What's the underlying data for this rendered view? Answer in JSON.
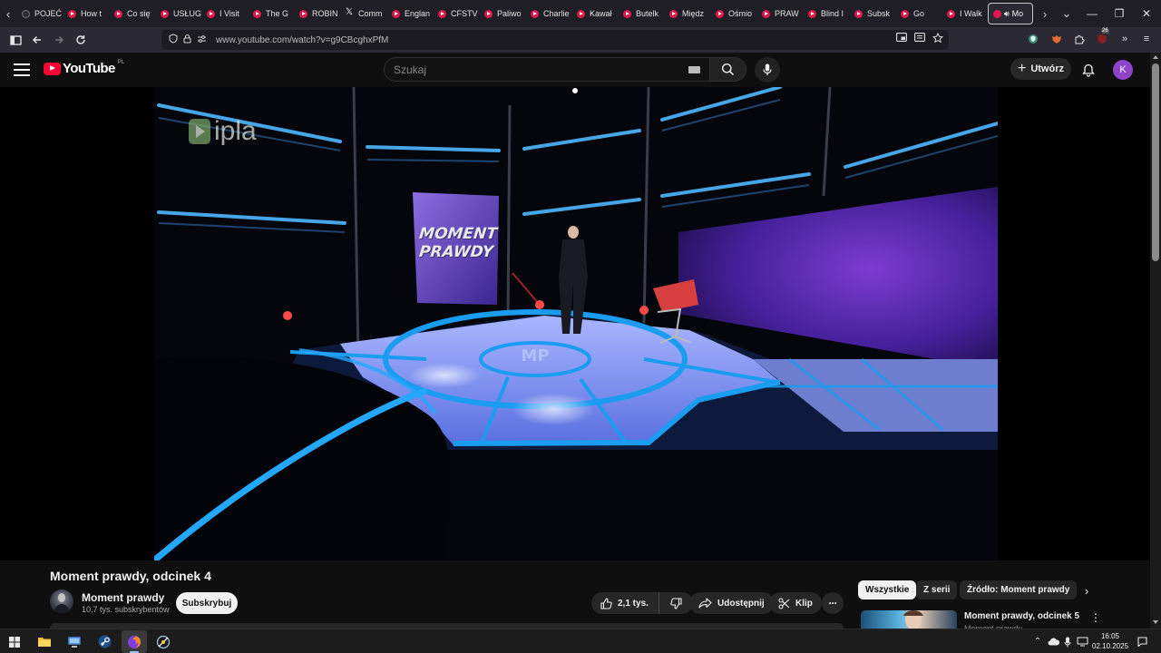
{
  "browser": {
    "tabs": [
      {
        "label": "POJEĆ",
        "icon": "plain"
      },
      {
        "label": "How t",
        "icon": "youtube"
      },
      {
        "label": "Co się",
        "icon": "youtube"
      },
      {
        "label": "USŁUG",
        "icon": "youtube"
      },
      {
        "label": "I Visit",
        "icon": "youtube"
      },
      {
        "label": "The G",
        "icon": "youtube"
      },
      {
        "label": "ROBIN",
        "icon": "youtube"
      },
      {
        "label": "Comm",
        "icon": "x"
      },
      {
        "label": "Englan",
        "icon": "youtube"
      },
      {
        "label": "CFSTV",
        "icon": "youtube"
      },
      {
        "label": "Paliwo",
        "icon": "youtube"
      },
      {
        "label": "Charlie",
        "icon": "youtube"
      },
      {
        "label": "Kawał",
        "icon": "youtube"
      },
      {
        "label": "Butelk",
        "icon": "youtube"
      },
      {
        "label": "Międz",
        "icon": "youtube"
      },
      {
        "label": "Ośmio",
        "icon": "youtube"
      },
      {
        "label": "PRAW",
        "icon": "youtube"
      },
      {
        "label": "Blind I",
        "icon": "youtube"
      },
      {
        "label": "Subsk",
        "icon": "youtube"
      },
      {
        "label": "Go",
        "icon": "youtube"
      },
      {
        "label": "I Walk",
        "icon": "youtube"
      }
    ],
    "active_tab": {
      "label": "Mo"
    },
    "url": "www.youtube.com/watch?v=g9CBcghxPfM",
    "extension_badge": "26"
  },
  "youtube": {
    "logo_text": "YouTube",
    "country_code": "PL",
    "search_placeholder": "Szukaj",
    "create_label": "Utwórz",
    "avatar_letter": "K"
  },
  "video": {
    "watermark": "ipla",
    "board_text_line1": "MOMENT",
    "board_text_line2": "PRAWDY",
    "title": "Moment prawdy, odcinek 4",
    "channel_name": "Moment prawdy",
    "subscribers": "10,7 tys. subskrybentów",
    "subscribe_label": "Subskrybuj",
    "likes": "2,1 tys.",
    "share_label": "Udostępnij",
    "clip_label": "Klip"
  },
  "sidebar": {
    "chips": [
      "Wszystkie",
      "Z serii",
      "Źródło: Moment prawdy"
    ],
    "recommendation": {
      "title": "Moment prawdy, odcinek 5",
      "channel": "Moment prawdy"
    }
  },
  "taskbar": {
    "time": "16:05",
    "date": "02.10.2025"
  },
  "colors": {
    "youtube_red": "#ff0033",
    "background": "#0f0f0f",
    "avatar_purple": "#8e44c9",
    "tab_favicon": "#e5164d"
  }
}
